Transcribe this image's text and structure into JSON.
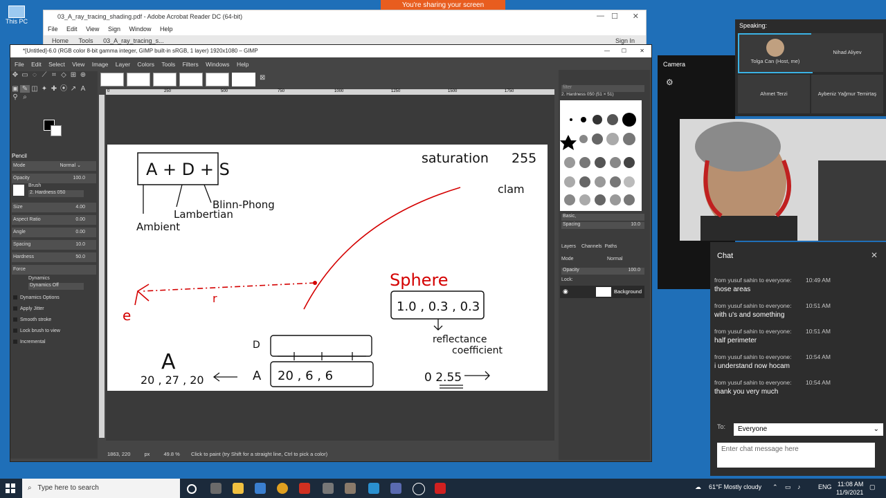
{
  "desktop": {
    "icons": [
      {
        "label": "This PC"
      }
    ],
    "sharing_banner": "You're sharing your screen"
  },
  "acrobat": {
    "title": "03_A_ray_tracing_shading.pdf - Adobe Acrobat Reader DC (64-bit)",
    "menu": [
      "File",
      "Edit",
      "View",
      "Sign",
      "Window",
      "Help"
    ],
    "tabs": [
      "Home",
      "Tools",
      "03_A_ray_tracing_s..."
    ],
    "sign_in": "Sign In"
  },
  "gimp": {
    "title": "*[Untitled]-6.0 (RGB color 8-bit gamma integer, GIMP built-in sRGB, 1 layer) 1920x1080 – GIMP",
    "menu": [
      "File",
      "Edit",
      "Select",
      "View",
      "Image",
      "Layer",
      "Colors",
      "Tools",
      "Filters",
      "Windows",
      "Help"
    ],
    "tool_options": {
      "tool_name": "Pencil",
      "mode_label": "Mode",
      "mode_value": "Normal",
      "opacity_label": "Opacity",
      "opacity_value": "100.0",
      "brush_label": "Brush",
      "brush_value": "2. Hardness 050",
      "rows": [
        {
          "label": "Size",
          "value": "4.00"
        },
        {
          "label": "Aspect Ratio",
          "value": "0.00"
        },
        {
          "label": "Angle",
          "value": "0.00"
        },
        {
          "label": "Spacing",
          "value": "10.0"
        },
        {
          "label": "Hardness",
          "value": "50.0"
        },
        {
          "label": "Force",
          "value": ""
        }
      ],
      "dynamics_label": "Dynamics",
      "dynamics_value": "Dynamics Off",
      "checks": [
        "Dynamics Options",
        "Apply Jitter",
        "Smooth stroke",
        "Lock brush to view",
        "Incremental"
      ]
    },
    "status": {
      "coords": "1863, 220",
      "unit": "px",
      "zoom": "49.8 %",
      "message": "Click to paint (try Shift for a straight line, Ctrl to pick a color)"
    },
    "ruler_labels": [
      "0",
      "250",
      "500",
      "750",
      "1000",
      "1250",
      "1500",
      "1750"
    ],
    "dock": {
      "filter_placeholder": "filter",
      "brush_selected": "2. Hardness 050 (51 × 51)",
      "brush_set": "Basic,",
      "spacing_label": "Spacing",
      "spacing_value": "10.0",
      "tabs": [
        "Layers",
        "Channels",
        "Paths"
      ],
      "mode_label": "Mode",
      "mode_value": "Normal",
      "opacity_label": "Opacity",
      "opacity_value": "100.0",
      "lock_label": "Lock:",
      "layer_name": "Background"
    },
    "drawing": {
      "formula": "A + D + S",
      "ambient": "Ambient",
      "lambertian": "Lambertian",
      "blinn": "Blinn-Phong",
      "saturation": "saturation",
      "sat_val": "255",
      "clamp": "clam",
      "sphere": "Sphere",
      "sphere_vals": "1.0 , 0.3 , 0.3",
      "reflectance": "reflectance",
      "coefficient": "coefficient",
      "r": "r",
      "e": "e",
      "A": "A",
      "A_vals": "20 , 27 , 20",
      "D": "D",
      "A2": "A",
      "A2_vals": "20 , 6 , 6",
      "bottom_val": "0 2.55"
    }
  },
  "teams": {
    "speaking": "Speaking:",
    "participants": [
      {
        "name": "Tolga Can (Host, me)"
      },
      {
        "name": "Nihad Aliyev"
      },
      {
        "name": "Ahmet Terzi"
      },
      {
        "name": "Aybeniz Yağmur Temirtaş"
      }
    ],
    "camera_label": "Camera"
  },
  "chat": {
    "title": "Chat",
    "messages": [
      {
        "from": "from yusuf sahin to everyone:",
        "time": "10:49 AM",
        "text": "those areas"
      },
      {
        "from": "from yusuf sahin to everyone:",
        "time": "10:51 AM",
        "text": "with u's and something"
      },
      {
        "from": "from yusuf sahin to everyone:",
        "time": "10:51 AM",
        "text": "half perimeter"
      },
      {
        "from": "from yusuf sahin to everyone:",
        "time": "10:54 AM",
        "text": "i understand now hocam"
      },
      {
        "from": "from yusuf sahin to everyone:",
        "time": "10:54 AM",
        "text": "thank you very much"
      }
    ],
    "to_label": "To:",
    "to_value": "Everyone",
    "input_placeholder": "Enter chat message here"
  },
  "taskbar": {
    "search_placeholder": "Type here to search",
    "weather": "61°F  Mostly cloudy",
    "lang": "ENG",
    "time": "11:08 AM",
    "date": "11/9/2021"
  }
}
